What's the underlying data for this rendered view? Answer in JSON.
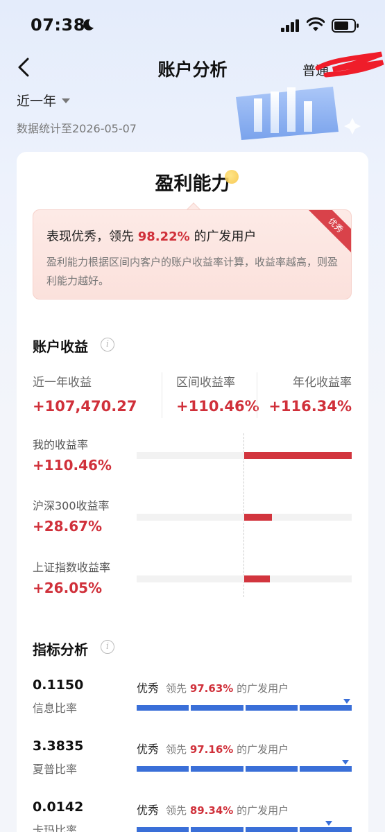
{
  "status": {
    "time": "07:38"
  },
  "nav": {
    "title": "账户分析",
    "right": "普通"
  },
  "period": {
    "label": "近一年",
    "stat_date": "数据统计至2026-05-07"
  },
  "ability": {
    "title": "盈利能力",
    "badge": "优秀",
    "headline_pre": "表现优秀，领先",
    "headline_pct": "98.22%",
    "headline_post": "的广发用户",
    "desc": "盈利能力根据区间内客户的账户收益率计算，收益率越高，则盈利能力越好。"
  },
  "returns": {
    "title": "账户收益",
    "kpis": [
      {
        "label": "近一年收益",
        "value": "+107,470.27"
      },
      {
        "label": "区间收益率",
        "value": "+110.46%"
      },
      {
        "label": "年化收益率",
        "value": "+116.34%"
      }
    ],
    "comparisons": [
      {
        "label": "我的收益率",
        "value": "+110.46%",
        "pct": 110.46
      },
      {
        "label": "沪深300收益率",
        "value": "+28.67%",
        "pct": 28.67
      },
      {
        "label": "上证指数收益率",
        "value": "+26.05%",
        "pct": 26.05
      }
    ]
  },
  "indicators": {
    "title": "指标分析",
    "lead_pre": "领先",
    "lead_post": "的广发用户",
    "items": [
      {
        "value": "0.1150",
        "label": "信息比率",
        "grade": "优秀",
        "pct": "97.63%",
        "level": 0.9763
      },
      {
        "value": "3.3835",
        "label": "夏普比率",
        "grade": "优秀",
        "pct": "97.16%",
        "level": 0.9716
      },
      {
        "value": "0.0142",
        "label": "卡玛比率",
        "grade": "优秀",
        "pct": "89.34%",
        "level": 0.8934
      }
    ]
  },
  "colors": {
    "up": "#d0303a",
    "bar": "#3a6fd8"
  }
}
